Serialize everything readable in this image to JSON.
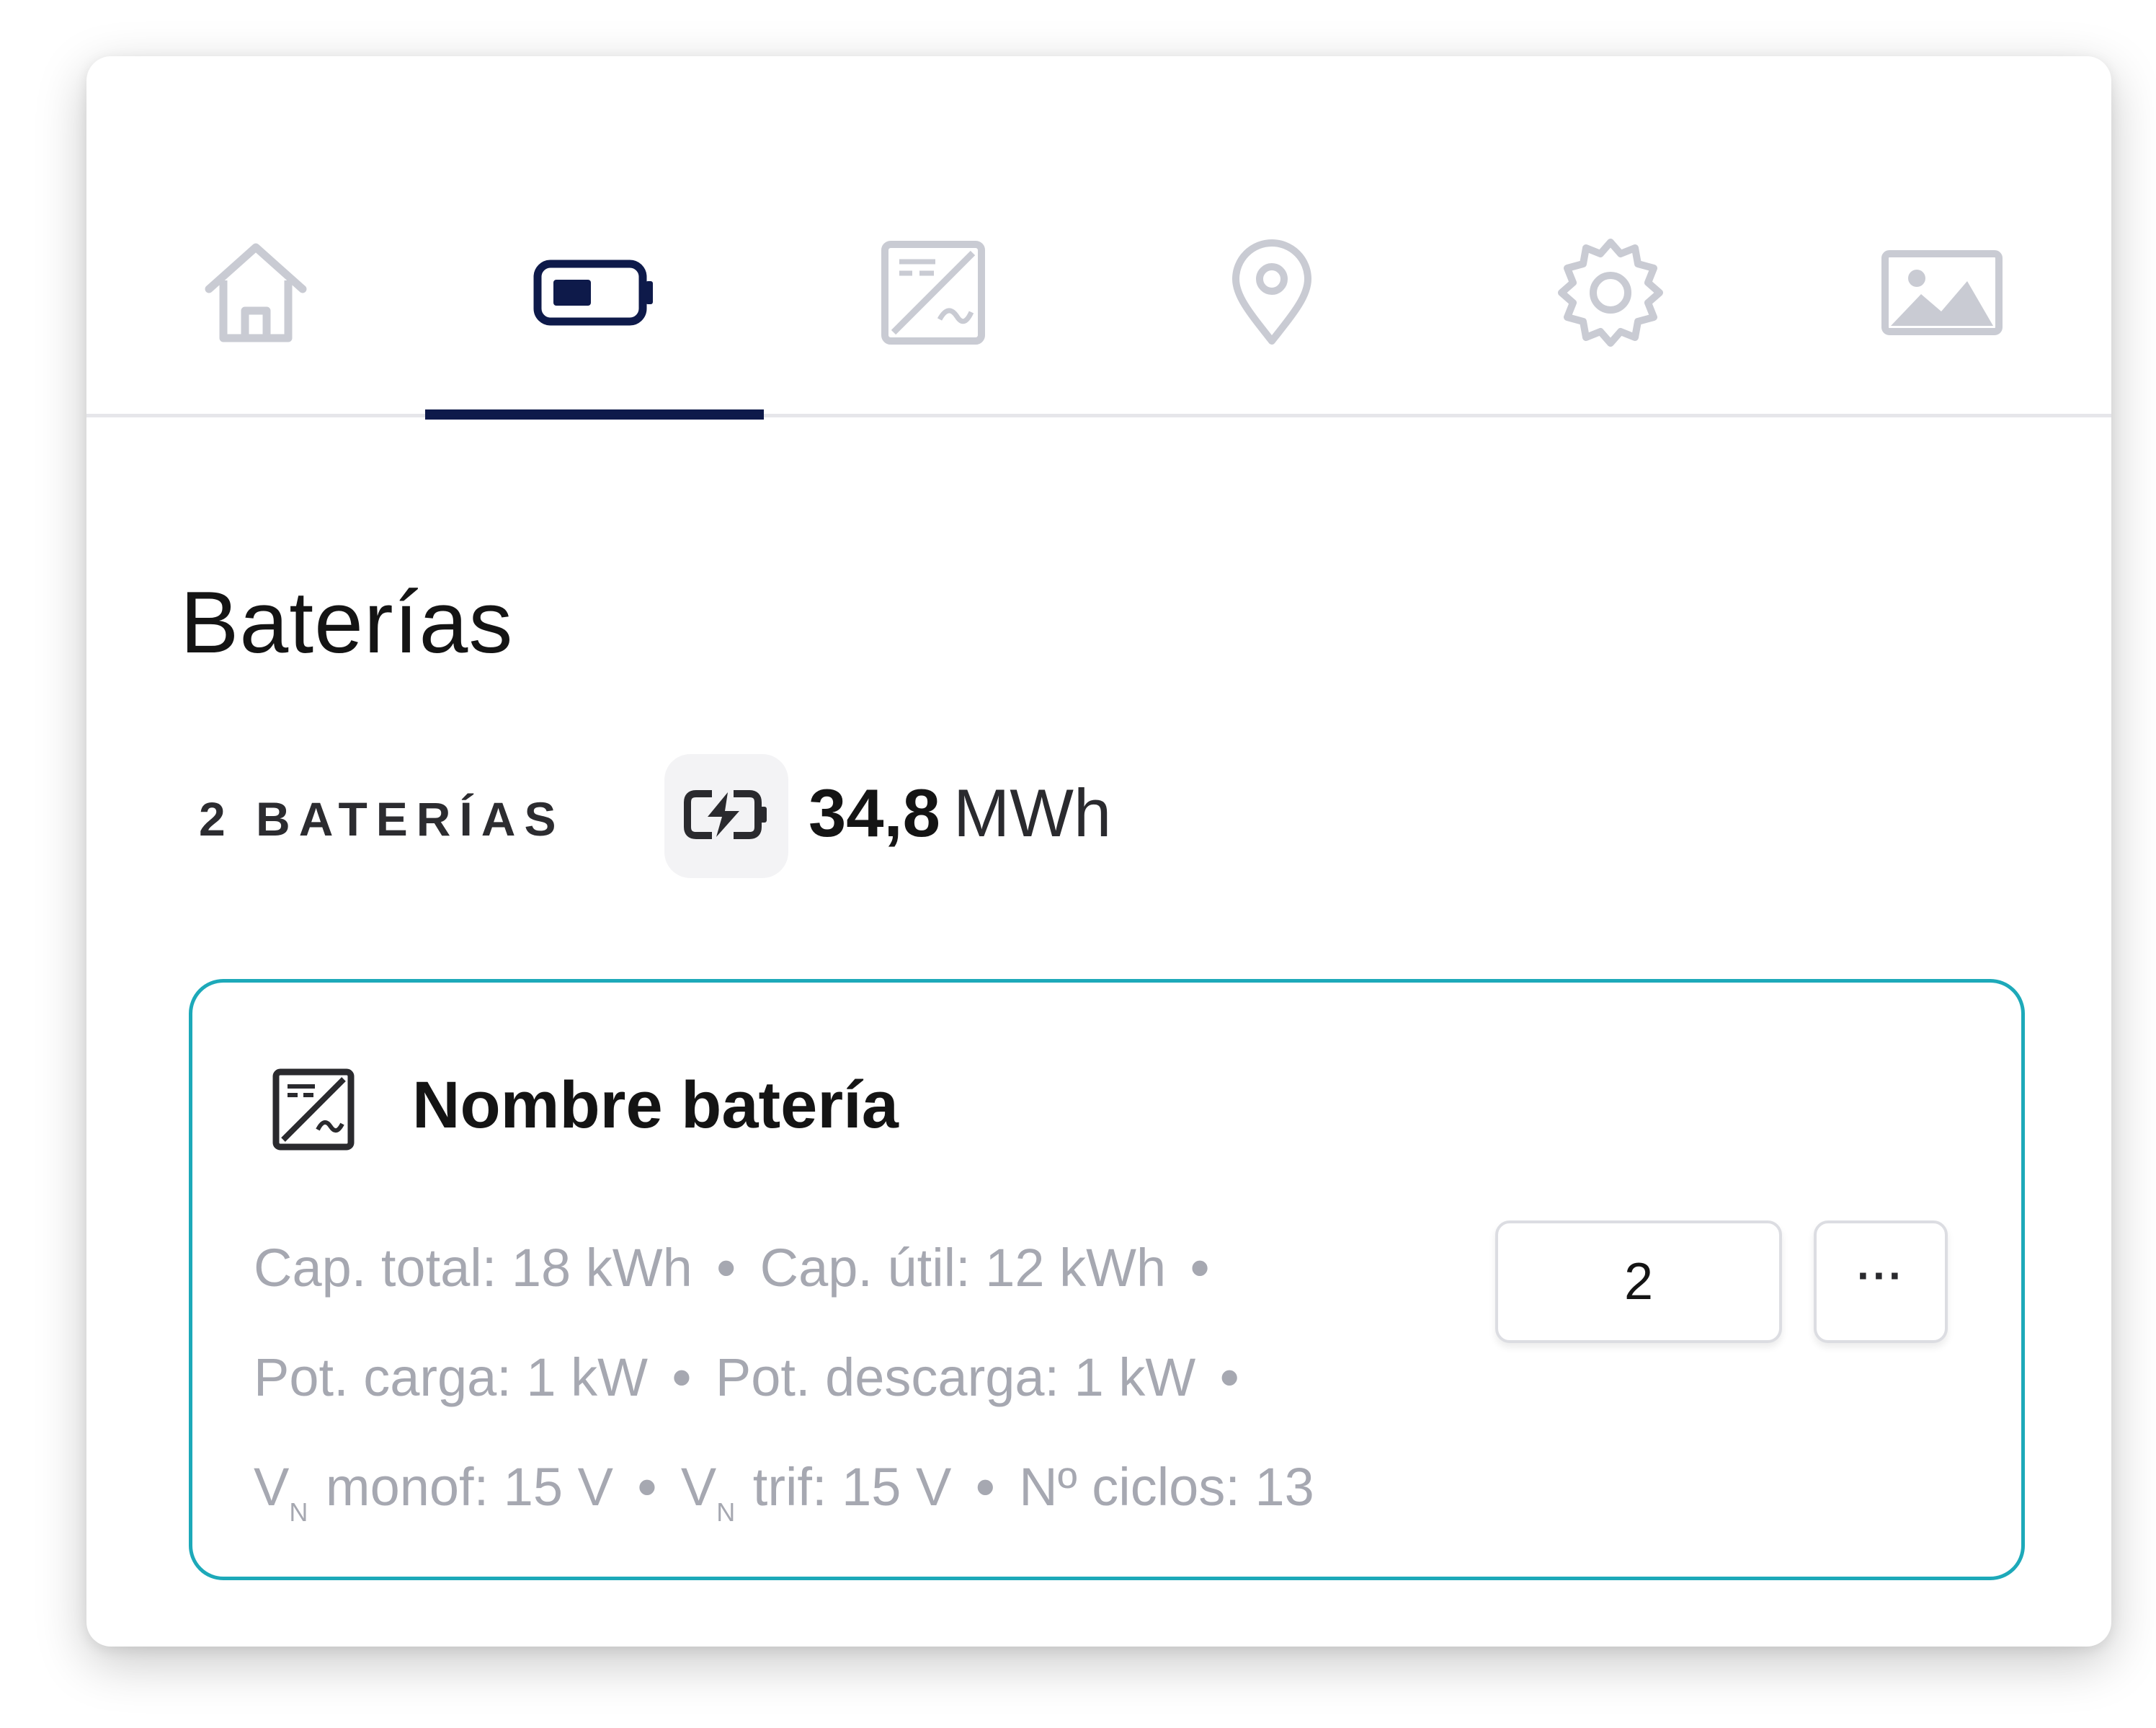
{
  "tabs": [
    {
      "icon": "home-icon",
      "active": false
    },
    {
      "icon": "battery-icon",
      "active": true
    },
    {
      "icon": "inverter-icon",
      "active": false
    },
    {
      "icon": "location-pin-icon",
      "active": false
    },
    {
      "icon": "gear-icon",
      "active": false
    },
    {
      "icon": "image-icon",
      "active": false
    }
  ],
  "colors": {
    "active_tab": "#0e1a4a",
    "inactive_tab": "#c9cbd3",
    "card_border": "#1da9b9",
    "muted_text": "#a6a8b1"
  },
  "section": {
    "title": "Baterías"
  },
  "summary": {
    "count_label": "2 BATERÍAS",
    "energy_value": "34,8",
    "energy_unit": "MWh",
    "energy_icon": "battery-charging-icon"
  },
  "battery_card": {
    "icon": "inverter-icon",
    "name": "Nombre batería",
    "specs": {
      "cap_total": "Cap. total: 18 kWh",
      "cap_util": "Cap. útil: 12 kWh",
      "pot_carga": "Pot. carga: 1 kW",
      "pot_descarga": "Pot. descarga: 1 kW",
      "vn_monof_symbol": "V",
      "vn_monof_sub": "N",
      "vn_monof_text": "monof: 15 V",
      "vn_trif_symbol": "V",
      "vn_trif_sub": "N",
      "vn_trif_text": "trif: 15 V",
      "ciclos": "Nº ciclos: 13"
    },
    "separator": "•",
    "quantity": "2",
    "more_label": "···"
  }
}
